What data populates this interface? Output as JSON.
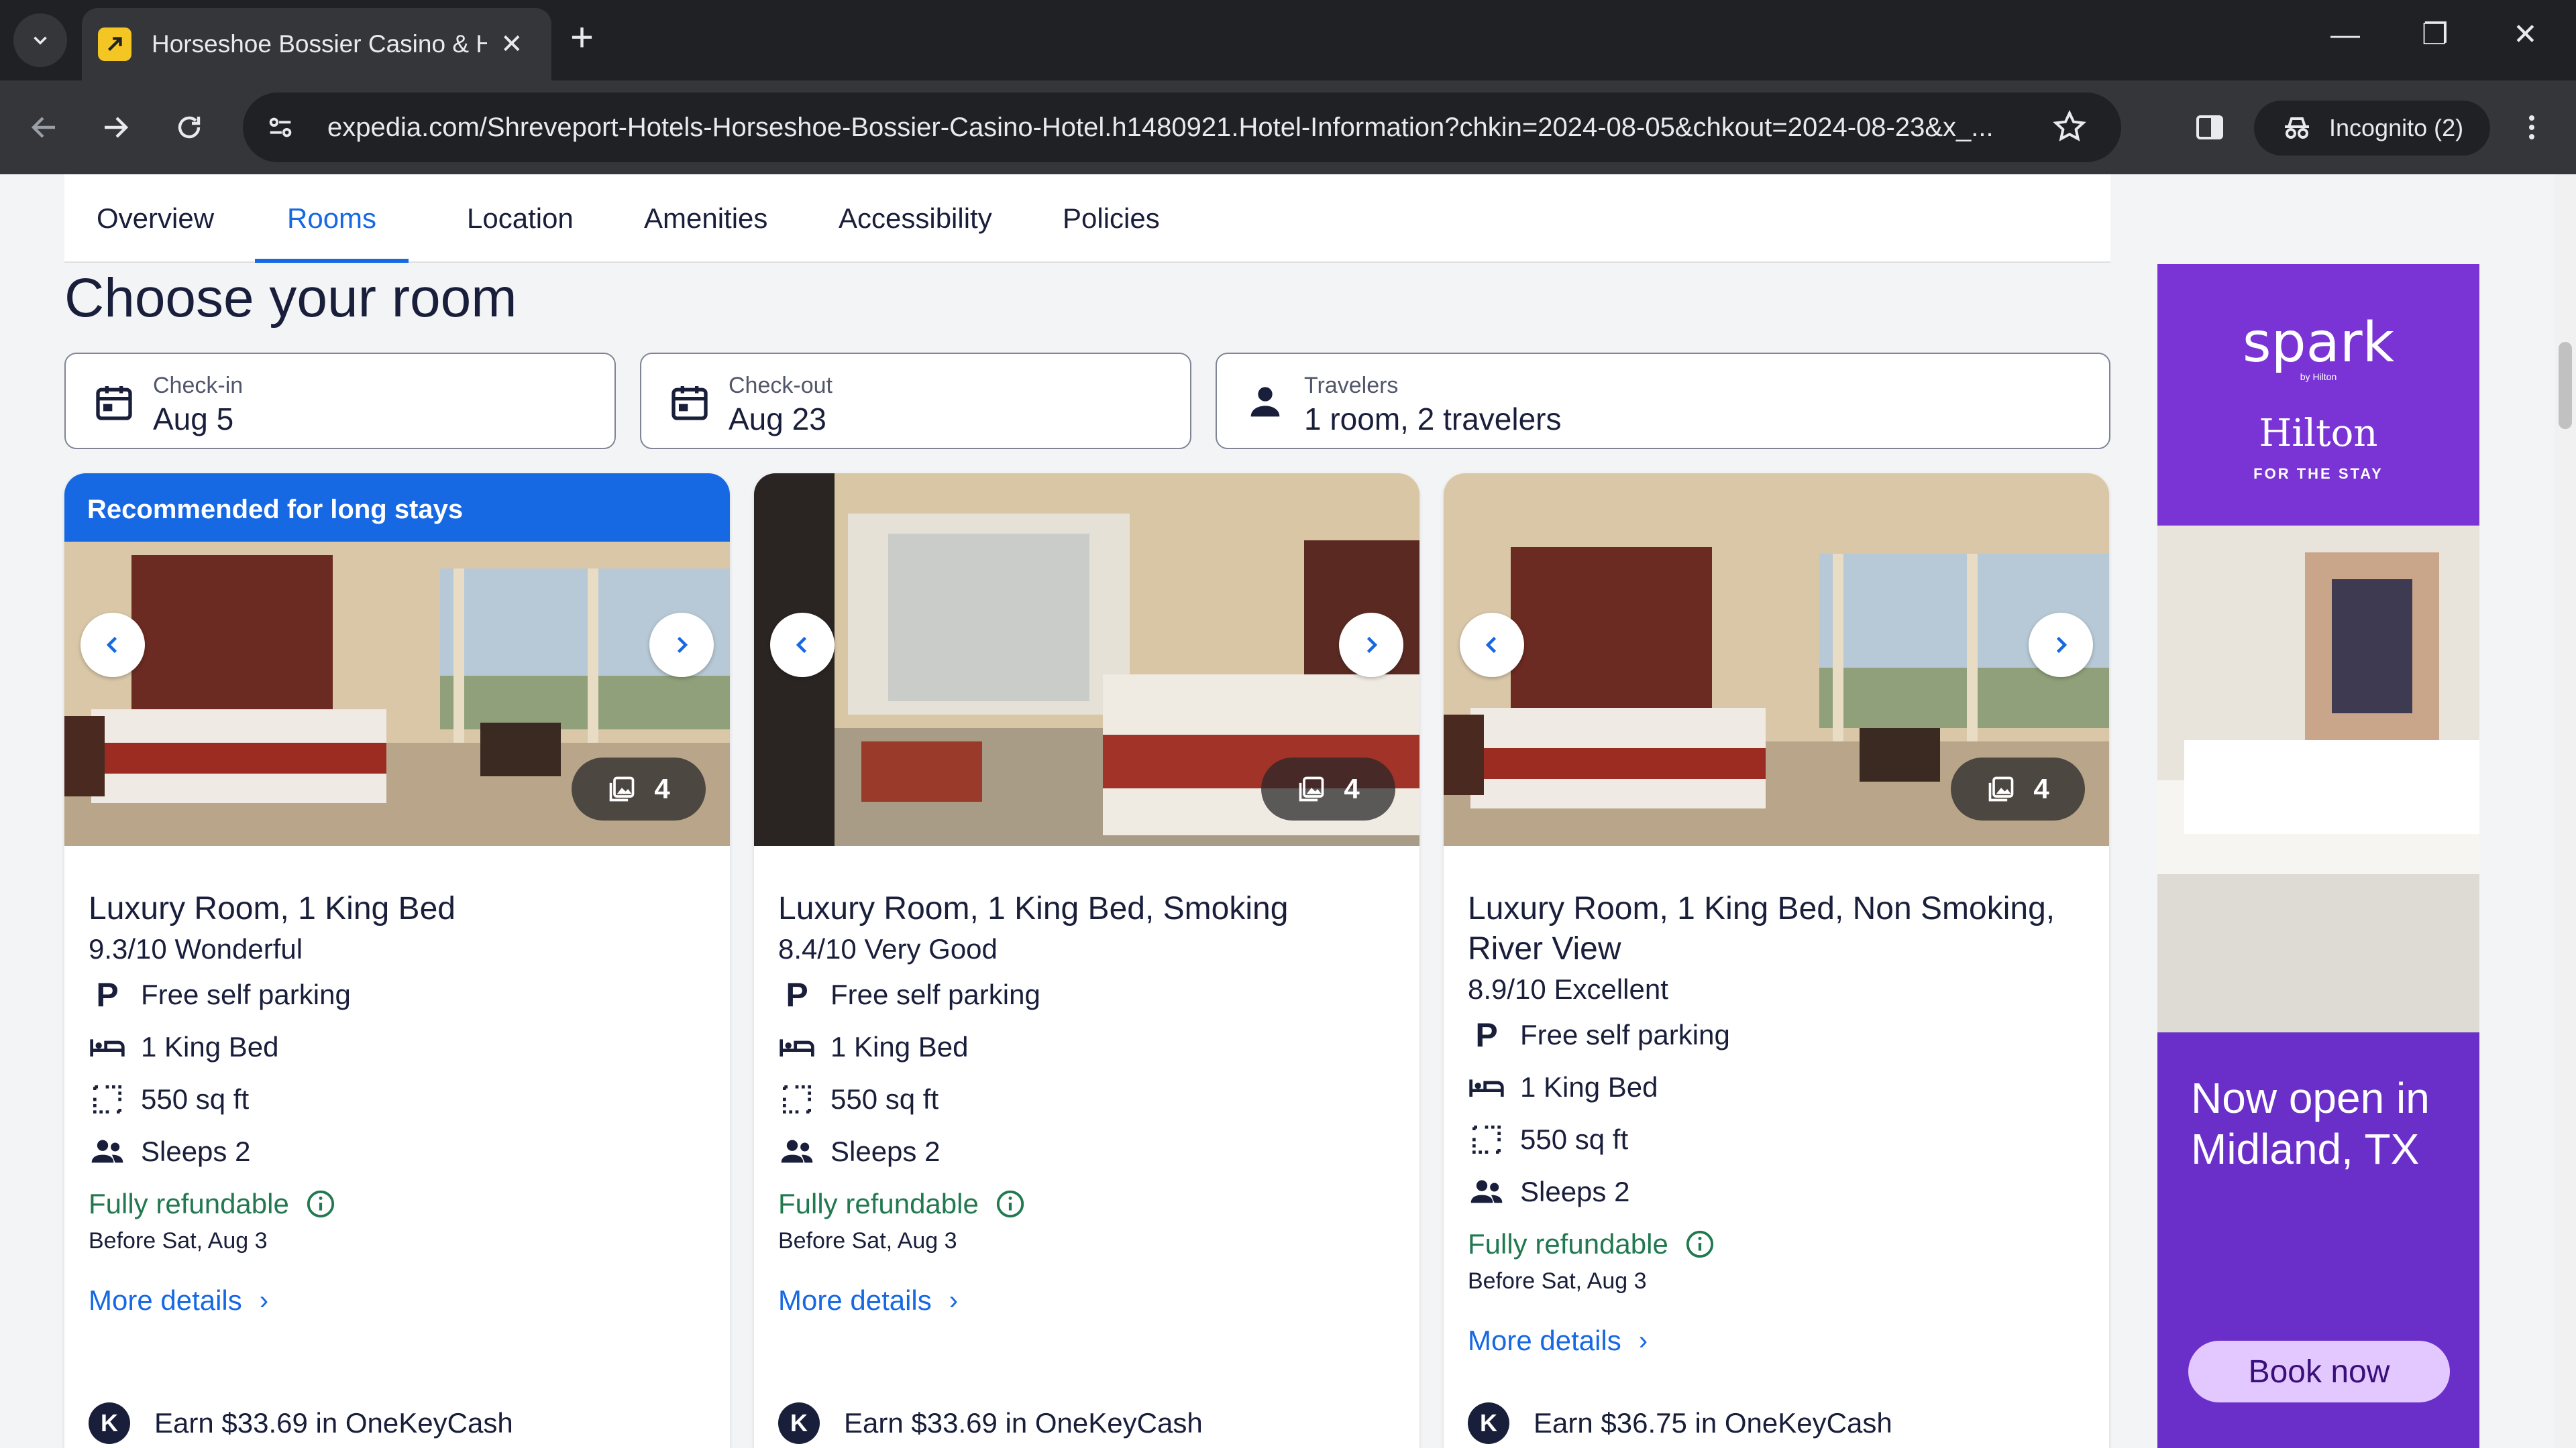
{
  "browser": {
    "tab_title": "Horseshoe Bossier Casino & Ho",
    "url": "expedia.com/Shreveport-Hotels-Horseshoe-Bossier-Casino-Hotel.h1480921.Hotel-Information?chkin=2024-08-05&chkout=2024-08-23&x_...",
    "incognito_label": "Incognito (2)",
    "tab_close": "✕",
    "new_tab": "+",
    "minimize": "—",
    "restore": "❐",
    "close": "✕"
  },
  "subnav": {
    "items": [
      {
        "label": "Overview"
      },
      {
        "label": "Rooms"
      },
      {
        "label": "Location"
      },
      {
        "label": "Amenities"
      },
      {
        "label": "Accessibility"
      },
      {
        "label": "Policies"
      }
    ],
    "active_index": 1
  },
  "heading": "Choose your room",
  "search": {
    "checkin_label": "Check-in",
    "checkin_value": "Aug 5",
    "checkout_label": "Check-out",
    "checkout_value": "Aug 23",
    "travelers_label": "Travelers",
    "travelers_value": "1 room, 2 travelers"
  },
  "cards": [
    {
      "badge": "Recommended for long stays",
      "photo_count": "4",
      "name": "Luxury Room, 1 King Bed",
      "rating": "9.3/10 Wonderful",
      "parking": "Free self parking",
      "bed": "1 King Bed",
      "size": "550 sq ft",
      "sleeps": "Sleeps 2",
      "refund": "Fully refundable",
      "refund_date": "Before Sat, Aug 3",
      "more": "More details",
      "onekey": "Earn $33.69 in OneKeyCash"
    },
    {
      "photo_count": "4",
      "name": "Luxury Room, 1 King Bed, Smoking",
      "rating": "8.4/10 Very Good",
      "parking": "Free self parking",
      "bed": "1 King Bed",
      "size": "550 sq ft",
      "sleeps": "Sleeps 2",
      "refund": "Fully refundable",
      "refund_date": "Before Sat, Aug 3",
      "more": "More details",
      "onekey": "Earn $33.69 in OneKeyCash"
    },
    {
      "photo_count": "4",
      "name": "Luxury Room, 1 King Bed, Non Smoking, River View",
      "rating": "8.9/10 Excellent",
      "parking": "Free self parking",
      "bed": "1 King Bed",
      "size": "550 sq ft",
      "sleeps": "Sleeps 2",
      "refund": "Fully refundable",
      "refund_date": "Before Sat, Aug 3",
      "more": "More details",
      "onekey": "Earn $36.75 in OneKeyCash"
    }
  ],
  "ad": {
    "brand": "spark",
    "brand_sub": "by Hilton",
    "hilton": "Hilton",
    "hilton_sub": "FOR THE STAY",
    "copy": "Now open in Midland, TX",
    "cta": "Book now"
  },
  "colors": {
    "accent": "#1668e3",
    "refund": "#227950",
    "ad_purple": "#6b2fc9"
  },
  "icons": [
    "search-icon",
    "calendar-icon",
    "person-icon",
    "parking-icon",
    "bed-icon",
    "area-icon",
    "people-icon",
    "info-icon",
    "gallery-icon",
    "chevron-left-icon",
    "chevron-right-icon"
  ]
}
